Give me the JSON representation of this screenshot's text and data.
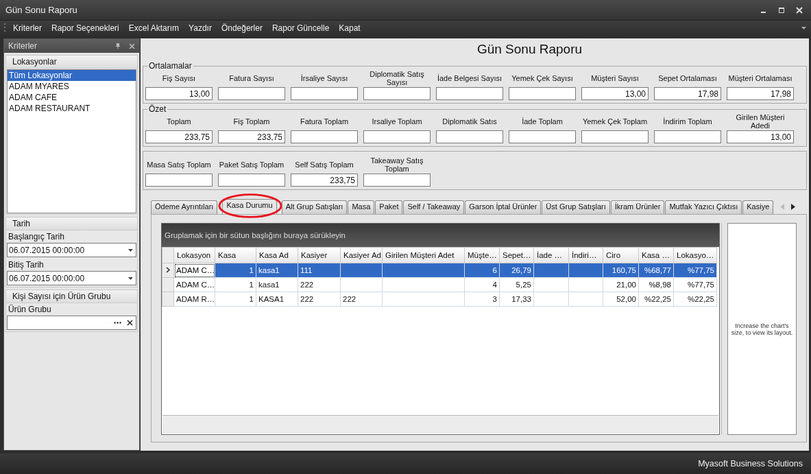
{
  "window": {
    "title": "Gün Sonu Raporu"
  },
  "menu": [
    "Kriterler",
    "Rapor Seçenekleri",
    "Excel Aktarım",
    "Yazdır",
    "Öndeğerler",
    "Rapor Güncelle",
    "Kapat"
  ],
  "sidebar": {
    "title": "Kriterler",
    "locations": {
      "title": "Lokasyonlar",
      "items": [
        {
          "label": "Tüm Lokasyonlar",
          "selected": true
        },
        {
          "label": "ADAM MYARES",
          "selected": false
        },
        {
          "label": "ADAM CAFE",
          "selected": false
        },
        {
          "label": "ADAM RESTAURANT",
          "selected": false
        }
      ]
    },
    "date": {
      "title": "Tarih",
      "fields": [
        {
          "label": "Başlangıç Tarih",
          "value": "06.07.2015 00:00:00"
        },
        {
          "label": "Bitiş Tarih",
          "value": "06.07.2015 00:00:00"
        }
      ]
    },
    "product_group": {
      "title": "Kişi Sayısı için Ürün Grubu",
      "label": "Ürün Grubu"
    }
  },
  "report_title": "Gün Sonu Raporu",
  "groups": [
    {
      "title": "Ortalamalar",
      "fields": [
        {
          "label": "Fiş Sayısı",
          "value": "13,00"
        },
        {
          "label": "Fatura Sayısı"
        },
        {
          "label": "İrsaliye Sayısı"
        },
        {
          "label": "Diplomatik Satış Sayısı"
        },
        {
          "label": "İade Belgesi Sayısı"
        },
        {
          "label": "Yemek Çek Sayısı"
        },
        {
          "label": "Müşteri Sayısı",
          "value": "13,00"
        },
        {
          "label": "Sepet Ortalaması",
          "value": "17,98"
        },
        {
          "label": "Müşteri Ortalaması",
          "value": "17,98"
        }
      ]
    },
    {
      "title": "Özet",
      "fields": [
        {
          "label": "Toplam",
          "value": "233,75"
        },
        {
          "label": "Fiş Toplam",
          "value": "233,75"
        },
        {
          "label": "Fatura Toplam"
        },
        {
          "label": "Irsaliye Toplam"
        },
        {
          "label": "Diplomatik Satıs"
        },
        {
          "label": "İade Toplam"
        },
        {
          "label": "Yemek Çek Toplam"
        },
        {
          "label": "İndirim Toplam"
        },
        {
          "label": "Girilen Müşteri Adedi",
          "value": "13,00"
        }
      ]
    },
    {
      "fields": [
        {
          "label": "Masa Satış Toplam"
        },
        {
          "label": "Paket Satış Toplam"
        },
        {
          "label": "Self Satış Toplam",
          "value": "233,75"
        },
        {
          "label": "Takeaway Satış Toplam"
        }
      ]
    }
  ],
  "tabs": [
    {
      "label": "Ödeme Ayrıntıları",
      "selected": false,
      "circled": false
    },
    {
      "label": "Kasa Durumu",
      "selected": true,
      "circled": true
    },
    {
      "label": "Alt Grup Satışları",
      "selected": false,
      "circled": false
    },
    {
      "label": "Masa",
      "selected": false,
      "circled": false
    },
    {
      "label": "Paket",
      "selected": false,
      "circled": false
    },
    {
      "label": "Self / Takeaway",
      "selected": false,
      "circled": false
    },
    {
      "label": "Garson İptal Ürünler",
      "selected": false,
      "circled": false
    },
    {
      "label": "Üst Grup Satışları",
      "selected": false,
      "circled": false
    },
    {
      "label": "İkram Ürünler",
      "selected": false,
      "circled": false
    },
    {
      "label": "Mutfak Yazıcı Çıktısı",
      "selected": false,
      "circled": false
    },
    {
      "label": "Kasiye",
      "selected": false,
      "circled": false
    }
  ],
  "grid": {
    "group_hint": "Gruplamak için bir sütun başlığını buraya sürükleyin",
    "columns": [
      "Lokasyon",
      "Kasa",
      "Kasa Ad",
      "Kasiyer",
      "Kasiyer Ad",
      "Girilen Müşteri Adet",
      "Müşte…",
      "Sepet…",
      "İade …",
      "İndiri…",
      "Ciro",
      "Kasa …",
      "Lokasyo…"
    ],
    "rows": [
      {
        "selected": true,
        "cells": [
          "ADAM C…",
          "1",
          "kasa1",
          "111",
          "",
          "",
          "6",
          "26,79",
          "",
          "",
          "160,75",
          "%68,77",
          "%77,75"
        ]
      },
      {
        "selected": false,
        "cells": [
          "ADAM C…",
          "1",
          "kasa1",
          "222",
          "",
          "",
          "4",
          "5,25",
          "",
          "",
          "21,00",
          "%8,98",
          "%77,75"
        ]
      },
      {
        "selected": false,
        "cells": [
          "ADAM R…",
          "1",
          "KASA1",
          "222",
          "222",
          "",
          "3",
          "17,33",
          "",
          "",
          "52,00",
          "%22,25",
          "%22,25"
        ]
      }
    ]
  },
  "chart_panel": {
    "message": "Increase the chart's size, to view its layout."
  },
  "status_bar": "Myasoft Business Solutions"
}
